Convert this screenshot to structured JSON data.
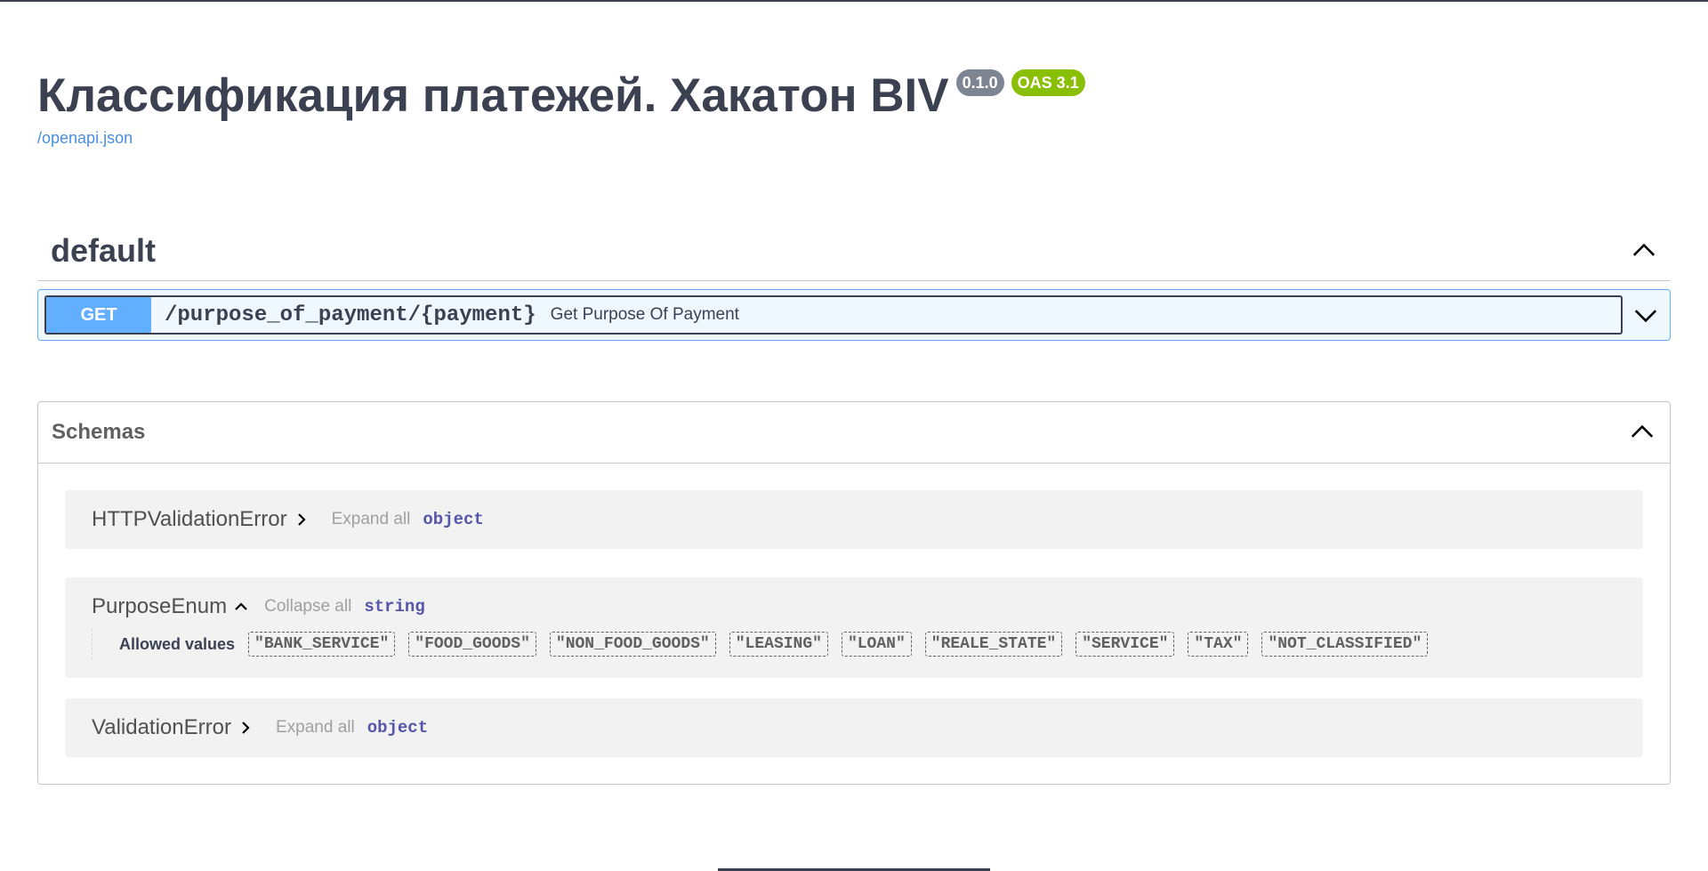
{
  "info": {
    "title": "Классификация платежей. Хакатон BIV",
    "version": "0.1.0",
    "oas": "OAS 3.1",
    "spec_link": "/openapi.json"
  },
  "tag": {
    "name": "default"
  },
  "operation": {
    "method": "GET",
    "path": "/purpose_of_payment/{payment}",
    "summary": "Get Purpose Of Payment"
  },
  "schemas": {
    "title": "Schemas",
    "models": [
      {
        "name": "HTTPValidationError",
        "toggle_label": "Expand all",
        "type": "object"
      },
      {
        "name": "PurposeEnum",
        "toggle_label": "Collapse all",
        "type": "string",
        "allowed_label": "Allowed values",
        "allowed_values": [
          "\"BANK_SERVICE\"",
          "\"FOOD_GOODS\"",
          "\"NON_FOOD_GOODS\"",
          "\"LEASING\"",
          "\"LOAN\"",
          "\"REALE_STATE\"",
          "\"SERVICE\"",
          "\"TAX\"",
          "\"NOT_CLASSIFIED\""
        ]
      },
      {
        "name": "ValidationError",
        "toggle_label": "Expand all",
        "type": "object"
      }
    ]
  },
  "colors": {
    "get_method": "#61affe",
    "version_badge": "#7d8492",
    "oas_badge": "#89bf04",
    "link": "#4990e2",
    "type_text": "#5555aa"
  },
  "icons": {
    "tag_toggle": "chevron-up-icon",
    "operation_toggle": "chevron-down-icon",
    "schemas_toggle": "chevron-up-icon",
    "model_collapsed": "chevron-right-icon",
    "model_expanded": "chevron-up-icon"
  }
}
